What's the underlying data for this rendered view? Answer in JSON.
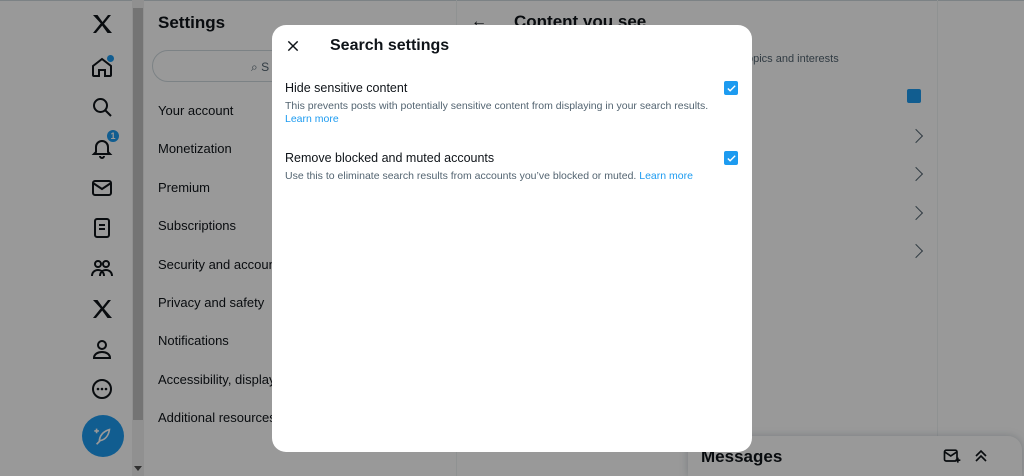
{
  "sidebar": {
    "icons": [
      "x-logo-icon",
      "home-icon",
      "search-icon",
      "bell-icon",
      "mail-icon",
      "list-icon",
      "communities-icon",
      "premium-x-icon",
      "profile-icon",
      "more-icon"
    ],
    "notification_count": "1"
  },
  "settings": {
    "title": "Settings",
    "search_placeholder": "S",
    "items": [
      {
        "label": "Your account"
      },
      {
        "label": "Monetization"
      },
      {
        "label": "Premium"
      },
      {
        "label": "Subscriptions"
      },
      {
        "label": "Security and account"
      },
      {
        "label": "Privacy and safety"
      },
      {
        "label": "Notifications"
      },
      {
        "label": "Accessibility, display"
      },
      {
        "label": "Additional resources"
      }
    ]
  },
  "content": {
    "title": "Content you see",
    "description": "opics and interests"
  },
  "messages": {
    "title": "Messages"
  },
  "modal": {
    "title": "Search settings",
    "options": [
      {
        "label": "Hide sensitive content",
        "description": "This prevents posts with potentially sensitive content from displaying in your search results.",
        "link": "Learn more",
        "checked": true
      },
      {
        "label": "Remove blocked and muted accounts",
        "description": "Use this to eliminate search results from accounts you’ve blocked or muted.",
        "link": "Learn more",
        "checked": true
      }
    ]
  },
  "colors": {
    "accent": "#1d9bf0",
    "text": "#0f1419",
    "muted": "#536471"
  }
}
